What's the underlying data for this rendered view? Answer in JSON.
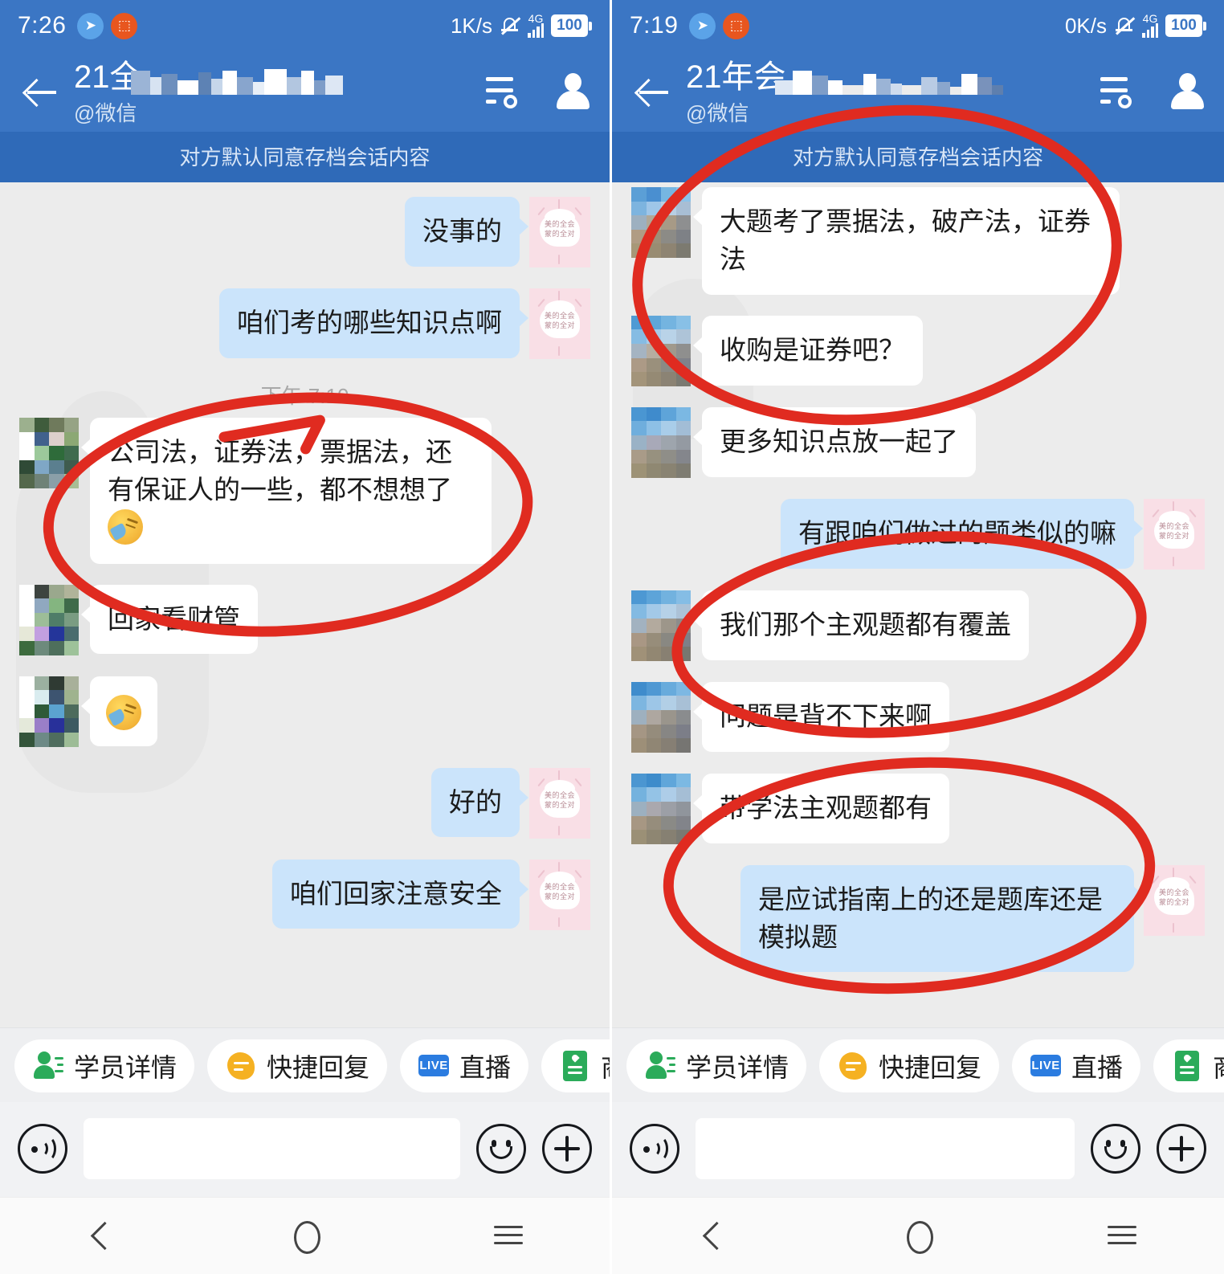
{
  "app": {
    "accent_color": "#3b76c4",
    "notice_bar_color": "#2f6ab8",
    "out_bubble_color": "#cbe4fb",
    "in_bubble_color": "#ffffff",
    "chat_background": "#ececec",
    "annotation_color": "#e02b20"
  },
  "panels": [
    {
      "status": {
        "time": "7:26",
        "network_speed": "1K/s",
        "network_type": "4G",
        "battery": "100",
        "bell_icon": "bell-muted-icon",
        "telegram_icon": "send-icon",
        "crop_icon": "screenshot-icon"
      },
      "header": {
        "back_icon": "back-arrow-icon",
        "title": "21全",
        "subtitle": "@微信",
        "filter_icon": "filter-settings-icon",
        "profile_icon": "person-icon"
      },
      "notice": "对方默认同意存档会话内容",
      "timestamp": "下午 7:10",
      "messages": [
        {
          "side": "out",
          "text": "没事的",
          "type": "text"
        },
        {
          "side": "out",
          "text": "咱们考的哪些知识点啊",
          "type": "text"
        },
        {
          "side": "in",
          "text": "公司法，证券法，票据法，还有保证人的一些，都不想想了",
          "type": "text",
          "emoji": true,
          "circled": true
        },
        {
          "side": "in",
          "text": "回家看财管",
          "type": "text"
        },
        {
          "side": "in",
          "text": "",
          "type": "emoji"
        },
        {
          "side": "out",
          "text": "好的",
          "type": "text"
        },
        {
          "side": "out",
          "text": "咱们回家注意安全",
          "type": "text"
        }
      ],
      "quick_actions": [
        {
          "label": "学员详情",
          "icon": "student-detail-icon"
        },
        {
          "label": "快捷回复",
          "icon": "quick-reply-icon"
        },
        {
          "label": "直播",
          "icon": "live-icon"
        },
        {
          "label": "商品图册",
          "icon": "product-catalog-icon"
        }
      ],
      "input": {
        "value": "",
        "placeholder": "",
        "voice_icon": "voice-icon",
        "emoji_icon": "smiley-icon",
        "plus_icon": "plus-icon"
      },
      "nav": {
        "back_icon": "nav-back-icon",
        "home_icon": "nav-home-icon",
        "recents_icon": "nav-recents-icon"
      }
    },
    {
      "status": {
        "time": "7:19",
        "network_speed": "0K/s",
        "network_type": "4G",
        "battery": "100",
        "bell_icon": "bell-muted-icon",
        "telegram_icon": "send-icon",
        "crop_icon": "screenshot-icon"
      },
      "header": {
        "back_icon": "back-arrow-icon",
        "title": "21年会",
        "subtitle": "@微信",
        "filter_icon": "filter-settings-icon",
        "profile_icon": "person-icon"
      },
      "notice": "对方默认同意存档会话内容",
      "timestamp": "",
      "messages": [
        {
          "side": "in",
          "text": "大题考了票据法，破产法，证券法",
          "type": "text",
          "circled": true
        },
        {
          "side": "in",
          "text": "收购是证券吧？",
          "type": "text",
          "circled": true
        },
        {
          "side": "in",
          "text": "更多知识点放一起了",
          "type": "text"
        },
        {
          "side": "out",
          "text": "有跟咱们做过的题类似的嘛",
          "type": "text"
        },
        {
          "side": "in",
          "text": "我们那个主观题都有覆盖",
          "type": "text",
          "circled": true
        },
        {
          "side": "in",
          "text": "问题是背不下来啊",
          "type": "text"
        },
        {
          "side": "in",
          "text": "带学法主观题都有",
          "type": "text",
          "circled": true
        },
        {
          "side": "out",
          "text": "是应试指南上的还是题库还是模拟题",
          "type": "text",
          "circled": true
        }
      ],
      "quick_actions": [
        {
          "label": "学员详情",
          "icon": "student-detail-icon"
        },
        {
          "label": "快捷回复",
          "icon": "quick-reply-icon"
        },
        {
          "label": "直播",
          "icon": "live-icon"
        },
        {
          "label": "商品图册",
          "icon": "product-catalog-icon"
        }
      ],
      "input": {
        "value": "",
        "placeholder": "",
        "voice_icon": "voice-icon",
        "emoji_icon": "smiley-icon",
        "plus_icon": "plus-icon"
      },
      "nav": {
        "back_icon": "nav-back-icon",
        "home_icon": "nav-home-icon",
        "recents_icon": "nav-recents-icon"
      }
    }
  ],
  "sticker_avatar_text": "美的全会 蒙的全对"
}
